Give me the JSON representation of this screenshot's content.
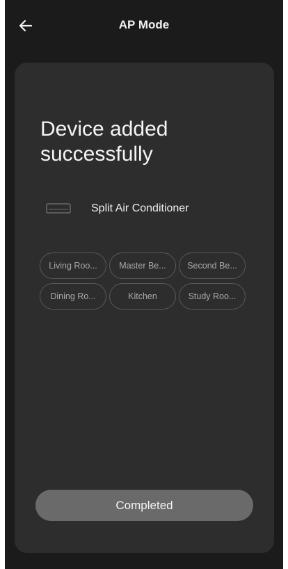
{
  "header": {
    "title": "AP Mode",
    "back_icon": "arrow-left-icon"
  },
  "main": {
    "headline_line1": "Device added",
    "headline_line2": "successfully",
    "device": {
      "icon": "air-conditioner-icon",
      "name": "Split Air Conditioner"
    },
    "rooms": [
      "Living Roo...",
      "Master Be...",
      "Second Be...",
      "Dining Ro...",
      "Kitchen",
      "Study Roo..."
    ],
    "complete_label": "Completed"
  },
  "colors": {
    "background": "#1c1b1c",
    "card": "#2e2d2e",
    "chip_border": "#5a595a",
    "button": "#6b6a6b",
    "text": "#f4f4f4"
  }
}
